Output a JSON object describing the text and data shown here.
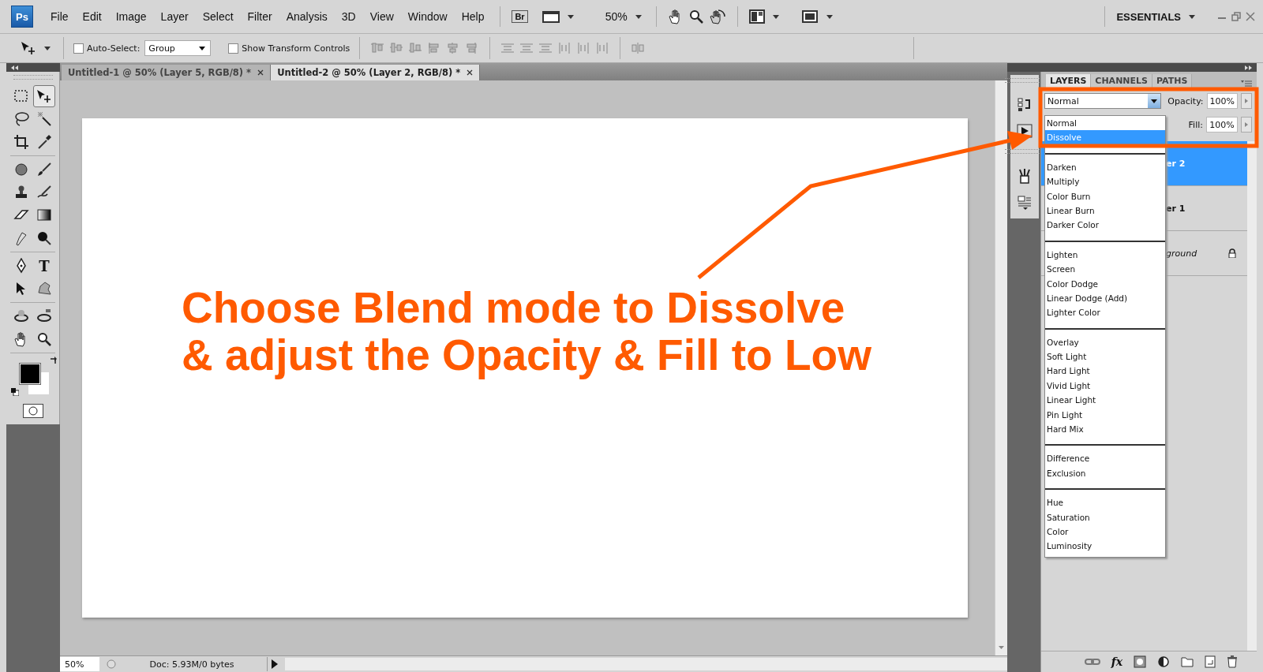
{
  "menu_bar": {
    "logo": "Ps",
    "items": [
      "File",
      "Edit",
      "Image",
      "Layer",
      "Select",
      "Filter",
      "Analysis",
      "3D",
      "View",
      "Window",
      "Help"
    ],
    "bridge": "Br",
    "zoom": "50%",
    "workspace": "ESSENTIALS"
  },
  "options_bar": {
    "auto_select": {
      "label": "Auto-Select:",
      "checked": false
    },
    "auto_select_target": "Group",
    "show_transform_controls": {
      "label": "Show Transform Controls",
      "checked": false
    }
  },
  "document_tabs": [
    {
      "title": "Untitled-1 @ 50% (Layer 5, RGB/8) *",
      "selected": false
    },
    {
      "title": "Untitled-2 @ 50% (Layer 2, RGB/8) *",
      "selected": true
    }
  ],
  "tool_groups": [
    {
      "tools": [
        {
          "kind": "marquee",
          "selected": false
        },
        {
          "kind": "move",
          "selected": true
        },
        {
          "kind": "lasso",
          "selected": false
        },
        {
          "kind": "magic_wand",
          "selected": false
        },
        {
          "kind": "crop",
          "selected": false
        },
        {
          "kind": "eyedropper",
          "selected": false
        }
      ]
    },
    {
      "tools": [
        {
          "kind": "healing",
          "selected": false
        },
        {
          "kind": "brush",
          "selected": false
        },
        {
          "kind": "stamp",
          "selected": false
        },
        {
          "kind": "history_brush",
          "selected": false
        },
        {
          "kind": "eraser",
          "selected": false
        },
        {
          "kind": "gradient",
          "selected": false
        },
        {
          "kind": "smudge",
          "selected": false
        },
        {
          "kind": "burn",
          "selected": false
        }
      ]
    },
    {
      "tools": [
        {
          "kind": "pen",
          "selected": false
        },
        {
          "kind": "type",
          "glyph": "T",
          "selected": false
        },
        {
          "kind": "path_select",
          "selected": false
        },
        {
          "kind": "shape",
          "selected": false
        }
      ]
    },
    {
      "tools": [
        {
          "kind": "rotate_3d",
          "selected": false
        },
        {
          "kind": "orbit_3d",
          "selected": false
        },
        {
          "kind": "hand",
          "selected": false
        },
        {
          "kind": "zoom",
          "selected": false
        }
      ]
    }
  ],
  "status_bar": {
    "zoom": "50%",
    "doc_info": "Doc: 5.93M/0 bytes"
  },
  "layers_panel": {
    "tabs": [
      {
        "label": "LAYERS",
        "selected": true
      },
      {
        "label": "CHANNELS",
        "selected": false
      },
      {
        "label": "PATHS",
        "selected": false
      }
    ],
    "blend_mode": "Normal",
    "opacity_label": "Opacity:",
    "opacity": "100%",
    "fill_label": "Fill:",
    "fill": "100%",
    "blend_menu": {
      "groups": [
        {
          "items": [
            {
              "label": "Normal",
              "selected": false
            },
            {
              "label": "Dissolve",
              "selected": true
            }
          ]
        },
        {
          "items": [
            {
              "label": "Darken",
              "selected": false
            },
            {
              "label": "Multiply",
              "selected": false
            },
            {
              "label": "Color Burn",
              "selected": false
            },
            {
              "label": "Linear Burn",
              "selected": false
            },
            {
              "label": "Darker Color",
              "selected": false
            }
          ]
        },
        {
          "items": [
            {
              "label": "Lighten",
              "selected": false
            },
            {
              "label": "Screen",
              "selected": false
            },
            {
              "label": "Color Dodge",
              "selected": false
            },
            {
              "label": "Linear Dodge (Add)",
              "selected": false
            },
            {
              "label": "Lighter Color",
              "selected": false
            }
          ]
        },
        {
          "items": [
            {
              "label": "Overlay",
              "selected": false
            },
            {
              "label": "Soft Light",
              "selected": false
            },
            {
              "label": "Hard Light",
              "selected": false
            },
            {
              "label": "Vivid Light",
              "selected": false
            },
            {
              "label": "Linear Light",
              "selected": false
            },
            {
              "label": "Pin Light",
              "selected": false
            },
            {
              "label": "Hard Mix",
              "selected": false
            }
          ]
        },
        {
          "items": [
            {
              "label": "Difference",
              "selected": false
            },
            {
              "label": "Exclusion",
              "selected": false
            }
          ]
        },
        {
          "items": [
            {
              "label": "Hue",
              "selected": false
            },
            {
              "label": "Saturation",
              "selected": false
            },
            {
              "label": "Color",
              "selected": false
            },
            {
              "label": "Luminosity",
              "selected": false
            }
          ]
        }
      ]
    },
    "layers": [
      {
        "name": "er 2",
        "kind": "normal",
        "selected": true,
        "locked": false
      },
      {
        "name": "er 1",
        "kind": "normal",
        "selected": false,
        "locked": false
      },
      {
        "name": "ground",
        "kind": "background",
        "selected": false,
        "locked": true
      }
    ],
    "fx_label": "fx"
  },
  "annotation": {
    "lines": [
      "Choose Blend mode to Dissolve",
      "& adjust the Opacity & Fill to Low"
    ]
  }
}
